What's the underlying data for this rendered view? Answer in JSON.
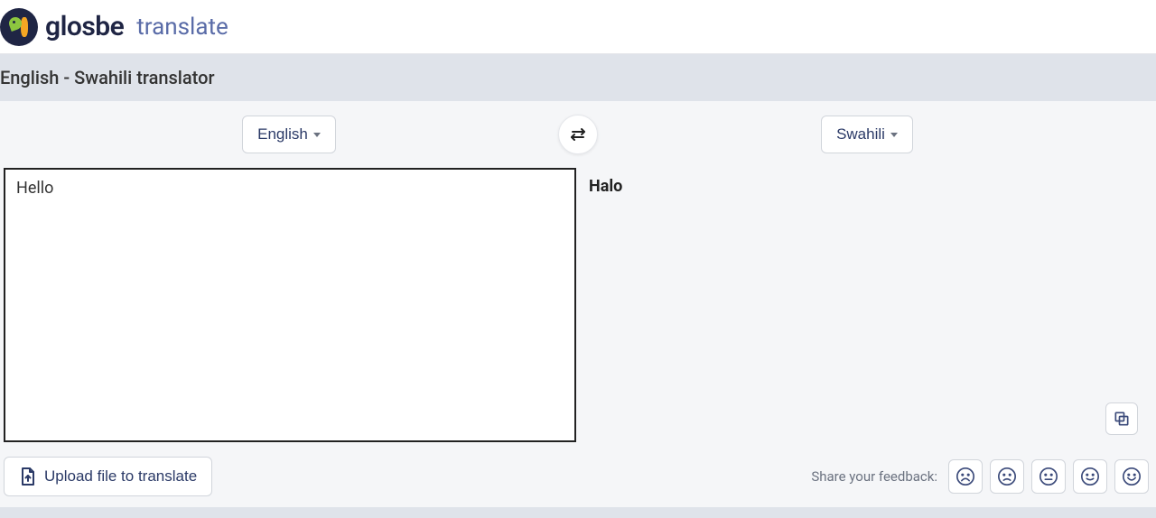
{
  "header": {
    "brand_main": "glosbe",
    "brand_sub": "translate"
  },
  "subheader": {
    "title": "English - Swahili translator"
  },
  "controls": {
    "source_lang": "English",
    "target_lang": "Swahili"
  },
  "panes": {
    "input_text": "Hello\n",
    "output_text": "Halo"
  },
  "footer": {
    "upload_label": "Upload file to translate",
    "feedback_label": "Share your feedback:"
  },
  "icons": {
    "swap": "swap-arrows-icon",
    "copy": "copy-icon",
    "upload": "upload-file-icon",
    "face_very_sad": "very-sad-face-icon",
    "face_sad": "sad-face-icon",
    "face_neutral": "neutral-face-icon",
    "face_happy": "happy-face-icon",
    "face_very_happy": "very-happy-face-icon"
  }
}
